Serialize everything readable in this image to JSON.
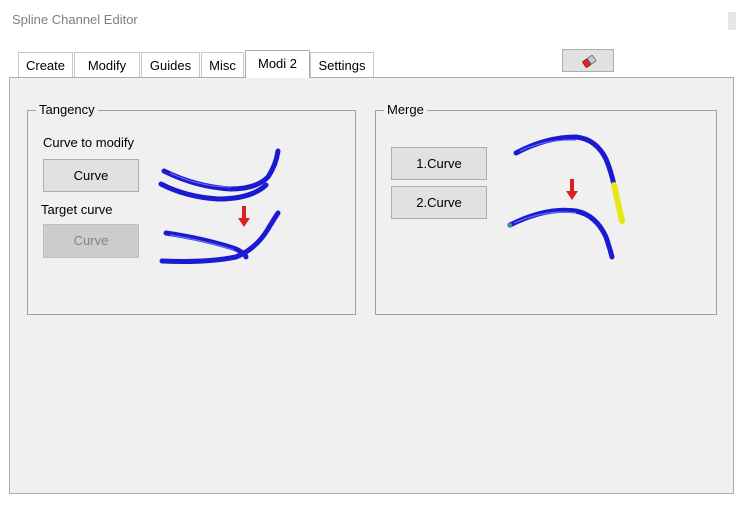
{
  "window": {
    "title": "Spline Channel Editor"
  },
  "tabs": [
    {
      "label": "Create",
      "active": false
    },
    {
      "label": "Modify",
      "active": false
    },
    {
      "label": "Guides",
      "active": false
    },
    {
      "label": "Misc",
      "active": false
    },
    {
      "label": "Modi 2",
      "active": true
    },
    {
      "label": "Settings",
      "active": false
    }
  ],
  "toolbar": {
    "icon": "eraser-icon"
  },
  "tangency": {
    "title": "Tangency",
    "curve_to_modify_label": "Curve to modify",
    "curve_button": "Curve",
    "target_curve_label": "Target curve",
    "target_button": "Curve"
  },
  "merge": {
    "title": "Merge",
    "curve1_button": "1.Curve",
    "curve2_button": "2.Curve"
  },
  "colors": {
    "curve_blue": "#1a1ad2",
    "curve_highlight": "#6a6af0",
    "arrow_red": "#e02020",
    "segment_yellow": "#e6e619",
    "panel_bg": "#f0f0f0"
  }
}
